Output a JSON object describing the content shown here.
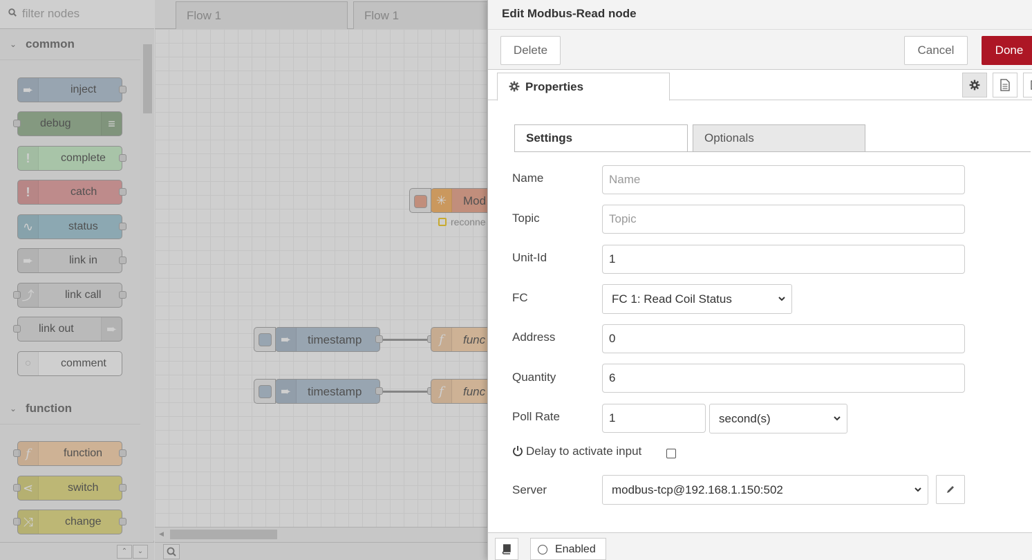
{
  "palette": {
    "filter_placeholder": "filter nodes",
    "categories": [
      {
        "label": "common"
      },
      {
        "label": "function"
      }
    ],
    "nodes": [
      {
        "label": "inject",
        "color": "#a6bbcf"
      },
      {
        "label": "debug",
        "color": "#87a980"
      },
      {
        "label": "complete",
        "color": "#c0edc0"
      },
      {
        "label": "catch",
        "color": "#e49191"
      },
      {
        "label": "status",
        "color": "#94c1d0"
      },
      {
        "label": "link in",
        "color": "#dddddd"
      },
      {
        "label": "link call",
        "color": "#dddddd"
      },
      {
        "label": "link out",
        "color": "#dddddd"
      },
      {
        "label": "comment",
        "color": "#ffffff"
      },
      {
        "label": "function",
        "color": "#fdd0a2"
      },
      {
        "label": "switch",
        "color": "#e2d96e"
      },
      {
        "label": "change",
        "color": "#e2d96e"
      }
    ]
  },
  "workspace": {
    "tabs": [
      {
        "label": "Flow 1"
      },
      {
        "label": "Flow 1"
      }
    ],
    "nodes": {
      "modbus_label": "Mod",
      "modbus_status": "reconne",
      "timestamp_1": "timestamp",
      "timestamp_2": "timestamp",
      "function_1": "func",
      "function_2": "func"
    }
  },
  "tray": {
    "title": "Edit Modbus-Read node",
    "delete_label": "Delete",
    "cancel_label": "Cancel",
    "done_label": "Done",
    "properties_tab": "Properties",
    "inner_tabs": {
      "settings": "Settings",
      "optionals": "Optionals"
    },
    "fields": {
      "name": {
        "label": "Name",
        "placeholder": "Name",
        "value": ""
      },
      "topic": {
        "label": "Topic",
        "placeholder": "Topic",
        "value": ""
      },
      "unit_id": {
        "label": "Unit-Id",
        "value": "1"
      },
      "fc": {
        "label": "FC",
        "value": "FC 1: Read Coil Status"
      },
      "address": {
        "label": "Address",
        "value": "0"
      },
      "quantity": {
        "label": "Quantity",
        "value": "6"
      },
      "poll_rate": {
        "label": "Poll Rate",
        "value": "1",
        "unit": "second(s)"
      },
      "delay": {
        "label": "Delay to activate input",
        "checked": false
      },
      "server": {
        "label": "Server",
        "value": "modbus-tcp@192.168.1.150:502"
      }
    },
    "footer": {
      "enabled_label": "Enabled"
    },
    "colors": {
      "done": "#ad1625"
    }
  }
}
